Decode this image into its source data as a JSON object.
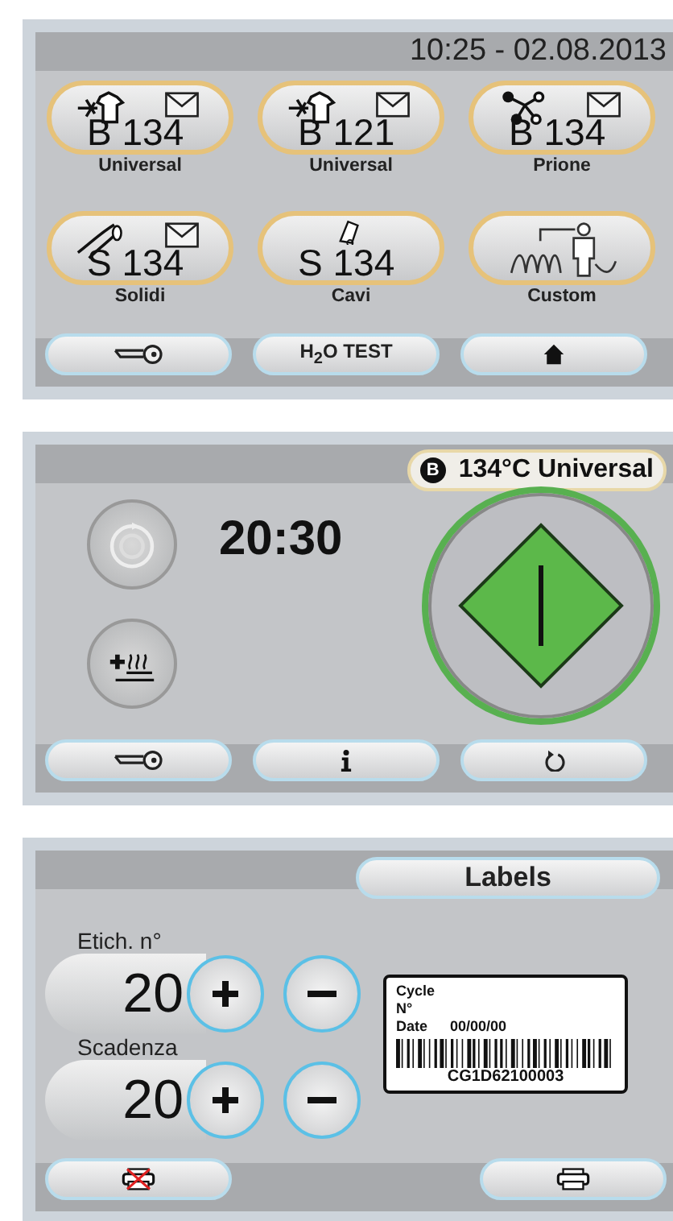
{
  "programs_screen": {
    "datetime": "10:25 - 02.08.2013",
    "programs": [
      {
        "kind": "instruments",
        "code": "B 134",
        "name": "Universal",
        "mail": true
      },
      {
        "kind": "instruments",
        "code": "B 121",
        "name": "Universal",
        "mail": true
      },
      {
        "kind": "prion",
        "code": "B 134",
        "name": "Prione",
        "mail": true
      },
      {
        "kind": "solids",
        "code": "S 134",
        "name": "Solidi",
        "mail": true
      },
      {
        "kind": "hollow",
        "code": "S 134",
        "name": "Cavi",
        "mail": false
      },
      {
        "kind": "custom",
        "name": "Custom",
        "mail": false
      }
    ],
    "buttons": [
      {
        "kind": "key"
      },
      {
        "kind": "text",
        "label": "H$_{2}$O TEST"
      },
      {
        "kind": "home"
      }
    ]
  },
  "cycle_screen": {
    "class_badge": "B",
    "program": "134°C Universal",
    "time": "20:30",
    "buttons": [
      {
        "kind": "key"
      },
      {
        "kind": "info"
      },
      {
        "kind": "back"
      }
    ]
  },
  "labels_screen": {
    "title": "Labels",
    "fields": [
      {
        "label": "Etich. n°",
        "value": "20"
      },
      {
        "label": "Scadenza",
        "value": "20"
      }
    ],
    "preview": {
      "line_1": "Cycle",
      "line_2": "N°",
      "date_label": "Date",
      "date": "00/00/00",
      "code": "CG1D62100003"
    },
    "buttons": [
      {
        "kind": "no-print"
      },
      {
        "kind": "print"
      }
    ]
  }
}
